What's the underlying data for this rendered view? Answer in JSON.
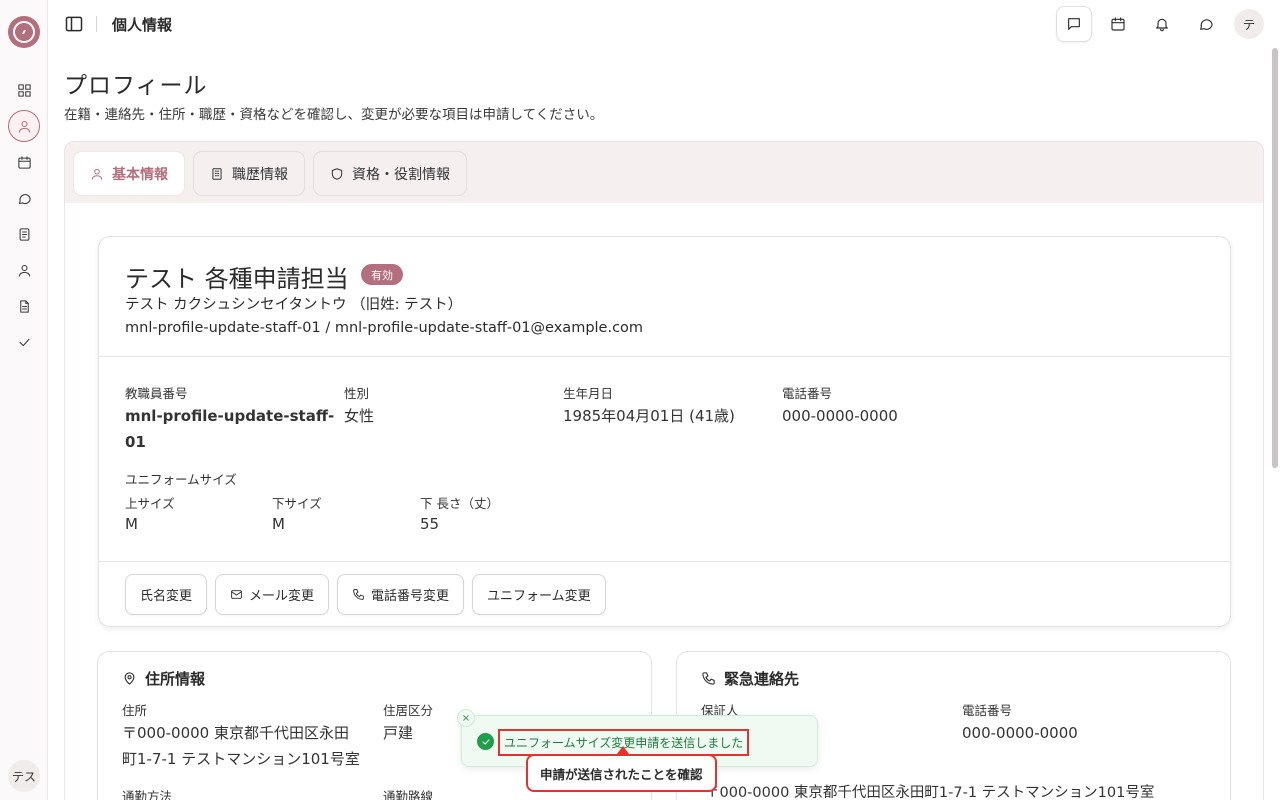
{
  "topbar": {
    "title": "個人情報"
  },
  "rail": {
    "user_initials": "テス"
  },
  "header": {
    "avatar_initial": "テ"
  },
  "page": {
    "title": "プロフィール",
    "subtitle": "在籍・連絡先・住所・職歴・資格などを確認し、変更が必要な項目は申請してください。"
  },
  "tabs": [
    {
      "label": "基本情報",
      "active": true
    },
    {
      "label": "職歴情報",
      "active": false
    },
    {
      "label": "資格・役割情報",
      "active": false
    }
  ],
  "profile": {
    "name": "テスト 各種申請担当",
    "status_badge": "有効",
    "kana": "テスト カクシュシンセイタントウ （旧姓: テスト）",
    "ids": "mnl-profile-update-staff-01 / mnl-profile-update-staff-01@example.com",
    "fields": {
      "staff_no_label": "教職員番号",
      "staff_no_line1": "mnl-profile-update-staff-",
      "staff_no_line2": "01",
      "gender_label": "性別",
      "gender": "女性",
      "birth_label": "生年月日",
      "birth": "1985年04月01日 (41歳)",
      "phone_label": "電話番号",
      "phone": "000-0000-0000",
      "uniform_label": "ユニフォームサイズ",
      "top_label": "上サイズ",
      "top": "M",
      "bottom_label": "下サイズ",
      "bottom": "M",
      "length_label": "下 長さ（丈）",
      "length": "55"
    },
    "actions": [
      "氏名変更",
      "メール変更",
      "電話番号変更",
      "ユニフォーム変更"
    ]
  },
  "address": {
    "title": "住所情報",
    "addr_label": "住所",
    "addr_line1": "〒000-0000 東京都千代田区永田",
    "addr_line2": "町1-7-1 テストマンション101号室",
    "type_label": "住居区分",
    "type": "戸建",
    "commute_label": "通勤方法",
    "route_label": "通勤路線"
  },
  "emergency": {
    "title": "緊急連絡先",
    "guarantor_label": "保証人",
    "phone_label": "電話番号",
    "phone": "000-0000-0000",
    "addr_partial": "〒000-0000 東京都千代田区永田町1-7-1 テストマンション101号室"
  },
  "toast": {
    "close": "×",
    "message": "ユニフォームサイズ変更申請を送信しました",
    "callout": "申請が送信されたことを確認"
  },
  "colors": {
    "accent": "#b36f7e",
    "success": "#1f9d4a",
    "highlight": "#e5312f"
  }
}
